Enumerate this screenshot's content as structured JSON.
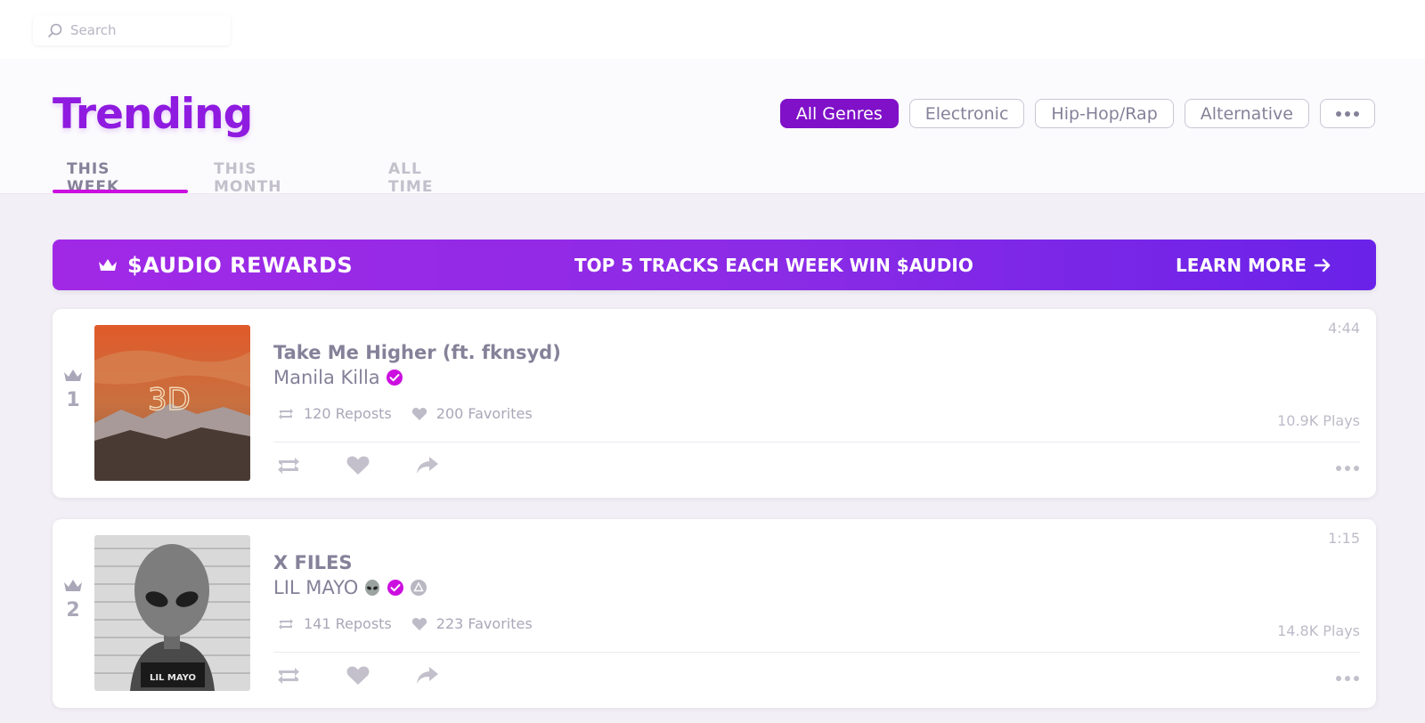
{
  "search": {
    "placeholder": "Search"
  },
  "page": {
    "title": "Trending"
  },
  "genres": [
    "All Genres",
    "Electronic",
    "Hip-Hop/Rap",
    "Alternative"
  ],
  "genre_more": "•••",
  "tabs": [
    "THIS WEEK",
    "THIS MONTH",
    "ALL TIME"
  ],
  "rewards": {
    "title": "$AUDIO REWARDS",
    "message": "TOP 5 TRACKS EACH WEEK WIN $AUDIO",
    "cta": "LEARN MORE"
  },
  "tracks": [
    {
      "rank": "1",
      "title": "Take Me Higher (ft. fknsyd)",
      "artist": "Manila Killa",
      "reposts": "120 Reposts",
      "favorites": "200 Favorites",
      "duration": "4:44",
      "plays": "10.9K Plays",
      "artwork_text": "3D"
    },
    {
      "rank": "2",
      "title": "X FILES",
      "artist": "LIL MAYO",
      "reposts": "141 Reposts",
      "favorites": "223 Favorites",
      "duration": "1:15",
      "plays": "14.8K Plays",
      "artwork_text": "LIL MAYO"
    }
  ],
  "colors": {
    "accent": "#8F1BE0",
    "pill_active": "#8011C8",
    "badge": "#CC0FE0",
    "tab_underline": "#CC0FE0"
  }
}
